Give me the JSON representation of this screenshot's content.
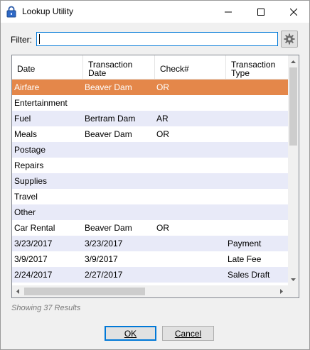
{
  "window": {
    "title": "Lookup Utility"
  },
  "filter": {
    "label": "Filter:",
    "value": ""
  },
  "columns": [
    "Date",
    "Transaction Date",
    "Check#",
    "Transaction Type"
  ],
  "rows": [
    {
      "c1": "Airfare",
      "c2": "Beaver Dam",
      "c3": "OR",
      "c4": ""
    },
    {
      "c1": "Entertainment",
      "c2": "",
      "c3": "",
      "c4": ""
    },
    {
      "c1": "Fuel",
      "c2": "Bertram Dam",
      "c3": "AR",
      "c4": ""
    },
    {
      "c1": "Meals",
      "c2": "Beaver Dam",
      "c3": "OR",
      "c4": ""
    },
    {
      "c1": "Postage",
      "c2": "",
      "c3": "",
      "c4": ""
    },
    {
      "c1": "Repairs",
      "c2": "",
      "c3": "",
      "c4": ""
    },
    {
      "c1": "Supplies",
      "c2": "",
      "c3": "",
      "c4": ""
    },
    {
      "c1": "Travel",
      "c2": "",
      "c3": "",
      "c4": ""
    },
    {
      "c1": "Other",
      "c2": "",
      "c3": "",
      "c4": ""
    },
    {
      "c1": "Car Rental",
      "c2": "Beaver Dam",
      "c3": "OR",
      "c4": ""
    },
    {
      "c1": "3/23/2017",
      "c2": "3/23/2017",
      "c3": "",
      "c4": "Payment"
    },
    {
      "c1": "3/9/2017",
      "c2": "3/9/2017",
      "c3": "",
      "c4": "Late Fee"
    },
    {
      "c1": "2/24/2017",
      "c2": "2/27/2017",
      "c3": "",
      "c4": "Sales Draft"
    }
  ],
  "selected_row": 0,
  "status": "Showing 37 Results",
  "buttons": {
    "ok": "OK",
    "cancel": "Cancel"
  },
  "colors": {
    "selection": "#e4874a",
    "alt_row": "#e8eaf8",
    "focus": "#0078d7"
  },
  "icons": {
    "app": "lock-icon",
    "settings": "gear-icon"
  }
}
